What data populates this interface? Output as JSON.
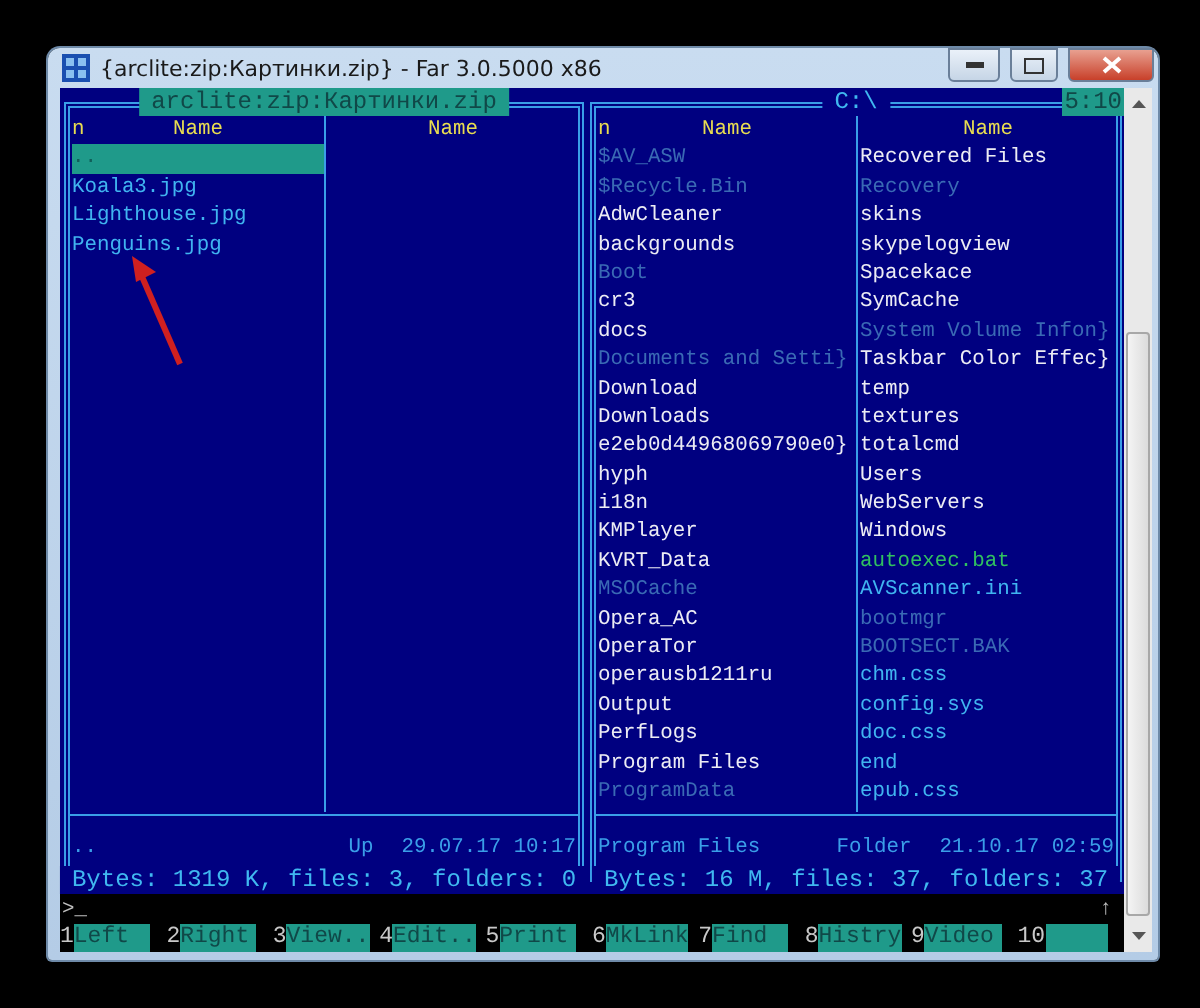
{
  "window": {
    "title": "{arclite:zip:Картинки.zip} - Far 3.0.5000 x86"
  },
  "clock": "5:10",
  "panels": [
    {
      "title": "arclite:zip:Картинки.zip",
      "active": true,
      "columns": [
        {
          "sort_mark": "n",
          "heading": "Name",
          "files": [
            {
              "name": "..",
              "kind": "file",
              "selected": true
            },
            {
              "name": "Koala3.jpg",
              "kind": "file",
              "selected": false
            },
            {
              "name": "Lighthouse.jpg",
              "kind": "file",
              "selected": false
            },
            {
              "name": "Penguins.jpg",
              "kind": "file",
              "selected": false
            }
          ]
        },
        {
          "heading": "Name"
        }
      ],
      "info": {
        "name": "..",
        "type": "Up",
        "date": "29.07.17 10:17"
      },
      "summary": "Bytes: 1319 K, files: 3, folders: 0"
    },
    {
      "title": "C:\\",
      "active": false,
      "columns": [
        {
          "sort_mark": "n",
          "heading": "Name",
          "files": [
            {
              "name": "$AV_ASW",
              "kind": "hidden",
              "selected": false
            },
            {
              "name": "$Recycle.Bin",
              "kind": "hidden",
              "selected": false
            },
            {
              "name": "AdwCleaner",
              "kind": "dir",
              "selected": false
            },
            {
              "name": "backgrounds",
              "kind": "dir",
              "selected": false
            },
            {
              "name": "Boot",
              "kind": "hidden",
              "selected": false
            },
            {
              "name": "cr3",
              "kind": "dir",
              "selected": false
            },
            {
              "name": "docs",
              "kind": "dir",
              "selected": false
            },
            {
              "name": "Documents and Setti}",
              "kind": "hidden",
              "selected": false
            },
            {
              "name": "Download",
              "kind": "dir",
              "selected": false
            },
            {
              "name": "Downloads",
              "kind": "dir",
              "selected": false
            },
            {
              "name": "e2eb0d44968069790e0}",
              "kind": "dir",
              "selected": false
            },
            {
              "name": "hyph",
              "kind": "dir",
              "selected": false
            },
            {
              "name": "i18n",
              "kind": "dir",
              "selected": false
            },
            {
              "name": "KMPlayer",
              "kind": "dir",
              "selected": false
            },
            {
              "name": "KVRT_Data",
              "kind": "dir",
              "selected": false
            },
            {
              "name": "MSOCache",
              "kind": "hidden",
              "selected": false
            },
            {
              "name": "Opera_AC",
              "kind": "dir",
              "selected": false
            },
            {
              "name": "OperaTor",
              "kind": "dir",
              "selected": false
            },
            {
              "name": "operausb1211ru",
              "kind": "dir",
              "selected": false
            },
            {
              "name": "Output",
              "kind": "dir",
              "selected": false
            },
            {
              "name": "PerfLogs",
              "kind": "dir",
              "selected": false
            },
            {
              "name": "Program Files",
              "kind": "dir",
              "selected": false
            },
            {
              "name": "ProgramData",
              "kind": "hidden",
              "selected": false
            }
          ]
        },
        {
          "heading": "Name",
          "files": [
            {
              "name": "Recovered Files",
              "kind": "dir",
              "selected": false
            },
            {
              "name": "Recovery",
              "kind": "hidden",
              "selected": false
            },
            {
              "name": "skins",
              "kind": "dir",
              "selected": false
            },
            {
              "name": "skypelogview",
              "kind": "dir",
              "selected": false
            },
            {
              "name": "Spacekace",
              "kind": "dir",
              "selected": false
            },
            {
              "name": "SymCache",
              "kind": "dir",
              "selected": false
            },
            {
              "name": "System Volume Infon}",
              "kind": "hidden",
              "selected": false
            },
            {
              "name": "Taskbar Color Effec}",
              "kind": "dir",
              "selected": false
            },
            {
              "name": "temp",
              "kind": "dir",
              "selected": false
            },
            {
              "name": "textures",
              "kind": "dir",
              "selected": false
            },
            {
              "name": "totalcmd",
              "kind": "dir",
              "selected": false
            },
            {
              "name": "Users",
              "kind": "dir",
              "selected": false
            },
            {
              "name": "WebServers",
              "kind": "dir",
              "selected": false
            },
            {
              "name": "Windows",
              "kind": "dir",
              "selected": false
            },
            {
              "name": "autoexec.bat",
              "kind": "exec",
              "selected": false
            },
            {
              "name": "AVScanner.ini",
              "kind": "file",
              "selected": false
            },
            {
              "name": "bootmgr",
              "kind": "hidden",
              "selected": false
            },
            {
              "name": "BOOTSECT.BAK",
              "kind": "hidden",
              "selected": false
            },
            {
              "name": "chm.css",
              "kind": "file",
              "selected": false
            },
            {
              "name": "config.sys",
              "kind": "file",
              "selected": false
            },
            {
              "name": "doc.css",
              "kind": "file",
              "selected": false
            },
            {
              "name": "end",
              "kind": "file",
              "selected": false
            },
            {
              "name": "epub.css",
              "kind": "file",
              "selected": false
            }
          ]
        }
      ],
      "info": {
        "name": "Program Files",
        "type": "Folder",
        "date": "21.10.17 02:59"
      },
      "summary": "Bytes: 16 M, files: 37, folders: 37"
    }
  ],
  "command_line": {
    "prompt": ">",
    "cursor": "_",
    "scroll_mark": "↑"
  },
  "keybar": [
    {
      "key": "1",
      "label": "Left"
    },
    {
      "key": "2",
      "label": "Right"
    },
    {
      "key": "3",
      "label": "View.."
    },
    {
      "key": "4",
      "label": "Edit.."
    },
    {
      "key": "5",
      "label": "Print"
    },
    {
      "key": "6",
      "label": "MkLink"
    },
    {
      "key": "7",
      "label": "Find"
    },
    {
      "key": "8",
      "label": "Histry"
    },
    {
      "key": "9",
      "label": "Video"
    },
    {
      "key": "10"
    }
  ]
}
